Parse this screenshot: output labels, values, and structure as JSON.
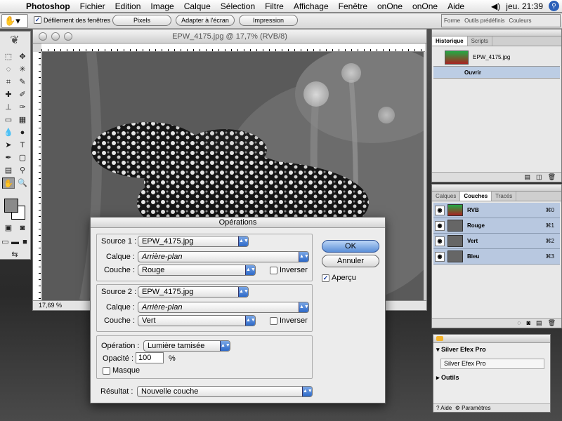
{
  "menubar": {
    "app": "Photoshop",
    "items": [
      "Fichier",
      "Edition",
      "Image",
      "Calque",
      "Sélection",
      "Filtre",
      "Affichage",
      "Fenêtre",
      "onOne",
      "onOne",
      "Aide"
    ],
    "clock": "jeu. 21:39"
  },
  "options": {
    "scroll_all": "Défilement des fenêtres",
    "buttons": [
      "Pixels",
      "Adapter à l'écran",
      "Impression"
    ],
    "palette_tabs": [
      "Forme",
      "Outils prédéfinis",
      "Couleurs"
    ]
  },
  "document": {
    "title": "EPW_4175.jpg @ 17,7% (RVB/8)",
    "zoom": "17,69 %"
  },
  "history": {
    "tabs": [
      "Historique",
      "Scripts"
    ],
    "snapshot": "EPW_4175.jpg",
    "state": "Ouvrir"
  },
  "channels": {
    "tabs": [
      "Calques",
      "Couches",
      "Tracés"
    ],
    "rows": [
      {
        "name": "RVB",
        "shortcut": "⌘0"
      },
      {
        "name": "Rouge",
        "shortcut": "⌘1"
      },
      {
        "name": "Vert",
        "shortcut": "⌘2"
      },
      {
        "name": "Bleu",
        "shortcut": "⌘3"
      }
    ]
  },
  "efex": {
    "title": "Silver Efex Pro",
    "field": "Silver Efex Pro",
    "section": "Outils",
    "help": "Aide",
    "params": "Paramètres"
  },
  "dialog": {
    "title": "Opérations",
    "source1": {
      "label": "Source 1 :",
      "file": "EPW_4175.jpg",
      "layer_label": "Calque :",
      "layer": "Arrière-plan",
      "channel_label": "Couche :",
      "channel": "Rouge",
      "invert": "Inverser"
    },
    "source2": {
      "label": "Source 2 :",
      "file": "EPW_4175.jpg",
      "layer_label": "Calque :",
      "layer": "Arrière-plan",
      "channel_label": "Couche :",
      "channel": "Vert",
      "invert": "Inverser"
    },
    "blending_label": "Opération :",
    "blending": "Lumière tamisée",
    "opacity_label": "Opacité :",
    "opacity": "100",
    "opacity_unit": "%",
    "mask": "Masque",
    "result_label": "Résultat :",
    "result": "Nouvelle couche",
    "ok": "OK",
    "cancel": "Annuler",
    "preview": "Aperçu"
  }
}
